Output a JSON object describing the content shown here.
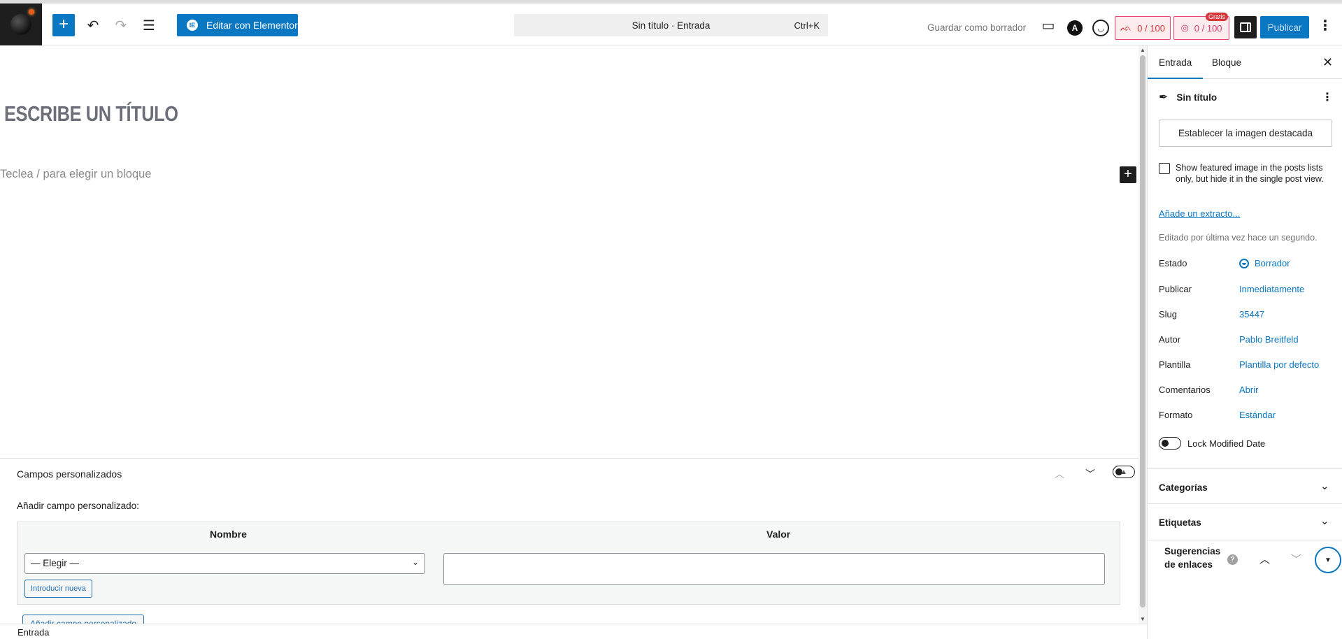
{
  "topbar": {
    "add_label": "+",
    "elementor_label": "Editar con Elementor",
    "elementor_logo": "IE",
    "command_title": "Sin título · Entrada",
    "command_shortcut": "Ctrl+K",
    "save_draft_label": "Guardar como borrador",
    "astra_glyph": "A",
    "seo_score": "0 / 100",
    "read_score": "0 / 100",
    "read_badge": "Gratis",
    "publish_label": "Publicar"
  },
  "editor": {
    "title_placeholder": "ESCRIBE UN TÍTULO",
    "block_placeholder": "Teclea / para elegir un bloque",
    "inline_add": "+"
  },
  "metabox": {
    "title": "Campos personalizados",
    "add_label": "Añadir campo personalizado:",
    "col_name": "Nombre",
    "col_value": "Valor",
    "select_value": "— Elegir —",
    "intro_button": "Introducir nueva",
    "add_button": "Añadir campo personalizado"
  },
  "footer": {
    "breadcrumb": "Entrada"
  },
  "sidebar": {
    "tab_post": "Entrada",
    "tab_block": "Bloque",
    "post_title": "Sin título",
    "featured_button": "Establecer la imagen destacada",
    "featured_checkbox": "Show featured image in the posts lists only, but hide it in the single post view.",
    "excerpt_link": "Añade un extracto...",
    "edited_text": "Editado por última vez hace un segundo.",
    "rows": [
      {
        "key": "Estado",
        "value": "Borrador"
      },
      {
        "key": "Publicar",
        "value": "Inmediatamente"
      },
      {
        "key": "Slug",
        "value": "35447"
      },
      {
        "key": "Autor",
        "value": "Pablo Breitfeld"
      },
      {
        "key": "Plantilla",
        "value": "Plantilla por defecto"
      },
      {
        "key": "Comentarios",
        "value": "Abrir"
      },
      {
        "key": "Formato",
        "value": "Estándar"
      }
    ],
    "lock_label": "Lock Modified Date",
    "panel_categories": "Categorías",
    "panel_tags": "Etiquetas",
    "suggest_label": "Sugerencias de enlaces",
    "help_glyph": "?"
  },
  "colors": {
    "accent": "#0a77c2",
    "score_red": "#d63638"
  }
}
